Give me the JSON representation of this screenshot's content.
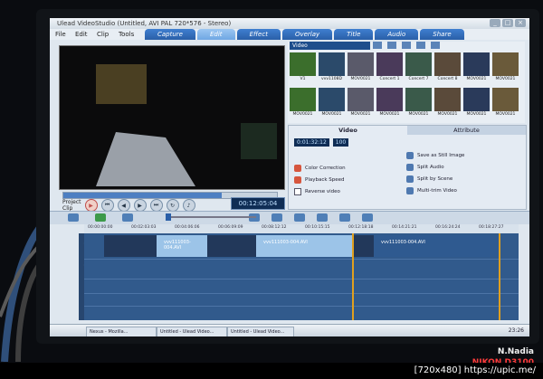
{
  "window": {
    "title": "Ulead VideoStudio (Untitled, AVI PAL 720*576 - Stereo)",
    "buttons": [
      "_",
      "□",
      "×"
    ]
  },
  "menu": {
    "items": [
      "File",
      "Edit",
      "Clip",
      "Tools"
    ]
  },
  "steps": {
    "tabs": [
      "Capture",
      "Edit",
      "Effect",
      "Overlay",
      "Title",
      "Audio",
      "Share"
    ],
    "active": "Edit"
  },
  "library": {
    "dropdown": "Video",
    "thumbnails": [
      "V1",
      "vvv1108D",
      "MOV0021",
      "Concert 1",
      "Concert 7",
      "Concert 8",
      "MOV0021",
      "MOV0021",
      "MOV0021",
      "MOV0021",
      "MOV0021",
      "MOV0021",
      "MOV0021",
      "MOV0021",
      "MOV0021",
      "MOV0021"
    ]
  },
  "player": {
    "project_label": "Project",
    "clip_label": "Clip",
    "timecode": "00:12:05:04",
    "progress": 0.74
  },
  "options": {
    "tabs": [
      "Video",
      "Attribute"
    ],
    "duration": "0:01:32:12",
    "volume": "100",
    "left_items": [
      "Color Correction",
      "Playback Speed",
      "Reverse video"
    ],
    "right_items": [
      "Save as Still Image",
      "Split Audio",
      "Split by Scene",
      "Multi-trim Video"
    ]
  },
  "timeline": {
    "ruler": [
      "00:00:00:00",
      "00:02:03:03",
      "00:04:06:06",
      "00:06:09:09",
      "00:08:12:12",
      "00:10:15:15",
      "00:12:18:18",
      "00:14:21:21",
      "00:16:24:24",
      "00:18:27:27"
    ],
    "clips": [
      "vvv111003-004.AVI",
      "vvv111003-004.AVI",
      "vvv111003-004.AVI"
    ]
  },
  "taskbar": {
    "tasks": [
      "Untitled - Ulead Video...",
      "Untitled - Ulead Video...",
      "Nexus - Mozilla..."
    ],
    "clock": "23:26"
  },
  "watermark": {
    "line1": "N.Nadia",
    "line2": "NIKON D3100"
  },
  "footer": "[720x480] https://upic.me/"
}
